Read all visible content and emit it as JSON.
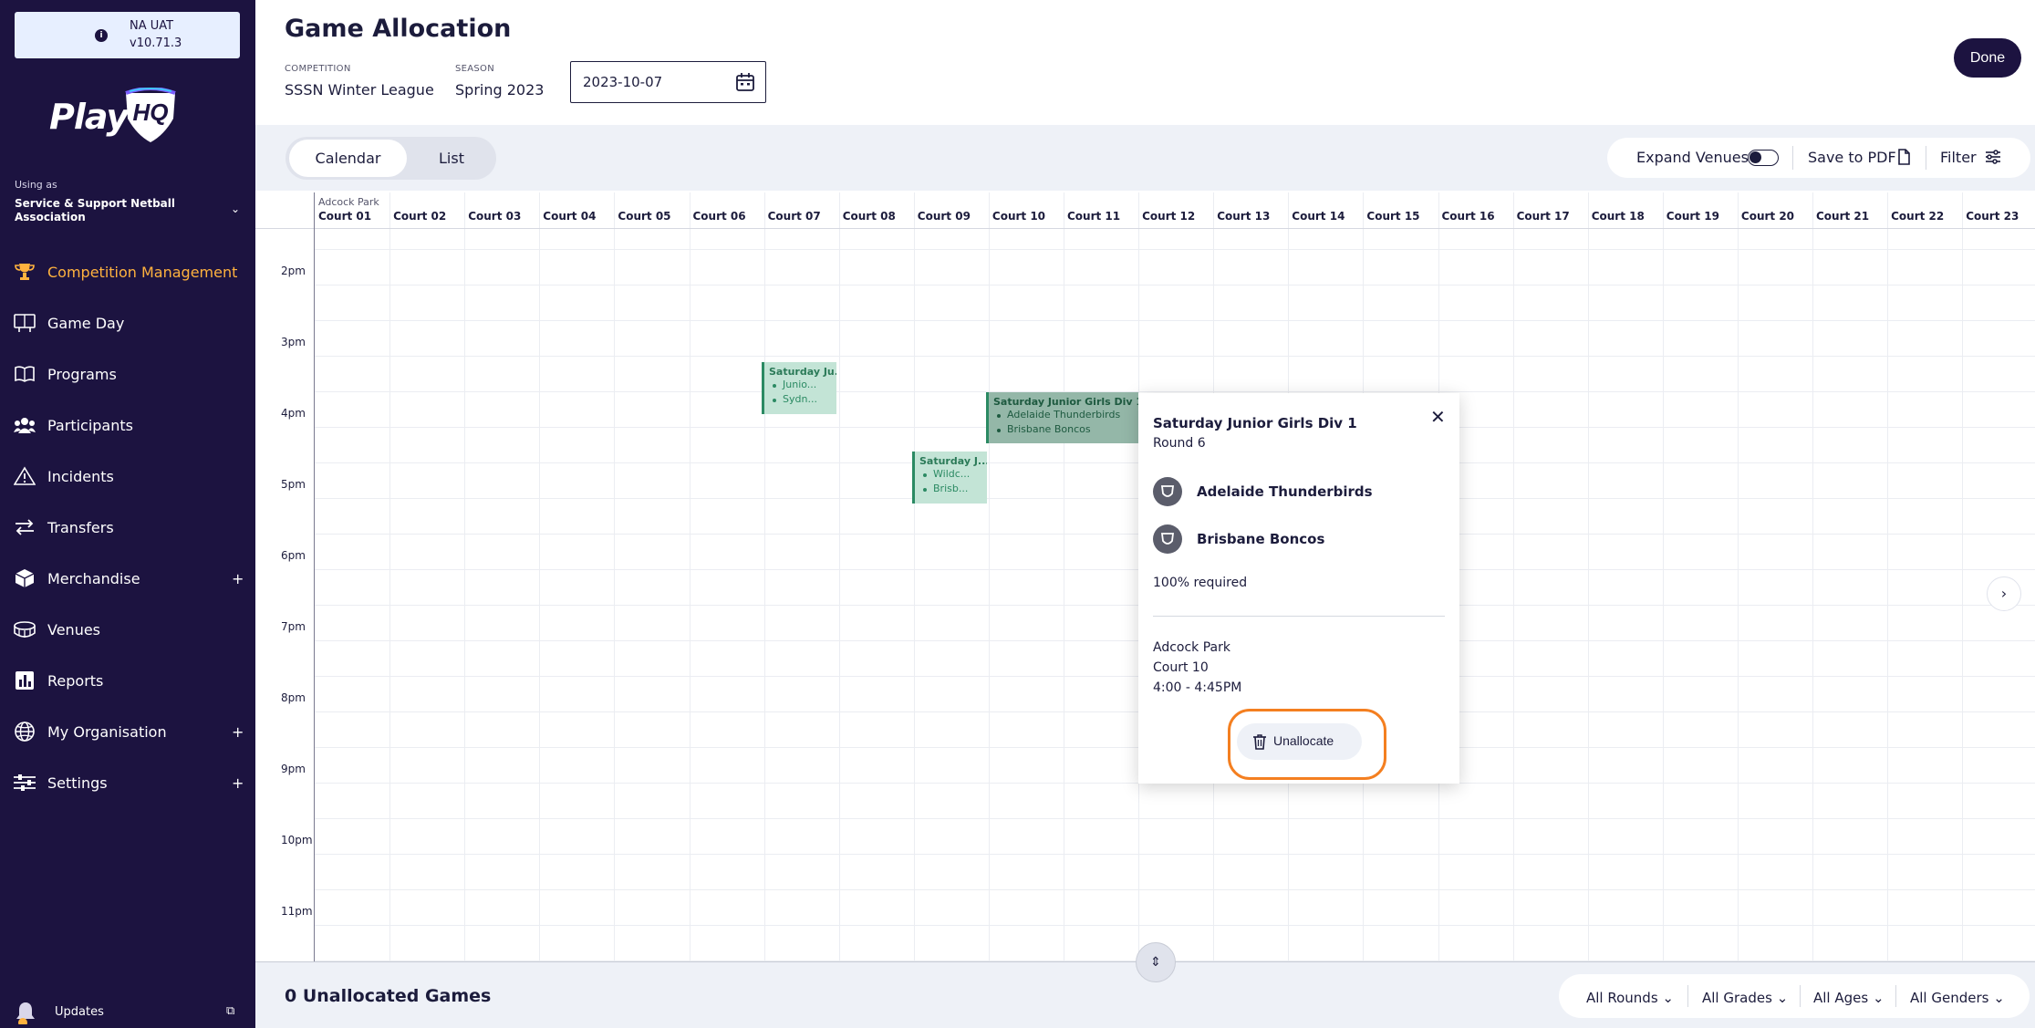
{
  "env": {
    "name": "NA UAT",
    "version": "v10.71.3"
  },
  "brand": {
    "play": "Play",
    "hq": "HQ",
    "accent": "#ffb23e",
    "sidebar_bg": "#1c1340"
  },
  "account": {
    "using_as_label": "Using as",
    "org": "Service & Support Netball Association"
  },
  "nav": [
    {
      "label": "Competition Management",
      "icon": "trophy-icon",
      "active": true
    },
    {
      "label": "Game Day",
      "icon": "scoreboard-icon"
    },
    {
      "label": "Programs",
      "icon": "book-icon"
    },
    {
      "label": "Participants",
      "icon": "people-icon"
    },
    {
      "label": "Incidents",
      "icon": "warning-icon"
    },
    {
      "label": "Transfers",
      "icon": "transfer-arrows-icon"
    },
    {
      "label": "Merchandise",
      "icon": "box-icon",
      "expand": "+"
    },
    {
      "label": "Venues",
      "icon": "stadium-icon"
    },
    {
      "label": "Reports",
      "icon": "chart-icon"
    },
    {
      "label": "My Organisation",
      "icon": "globe-icon",
      "expand": "+"
    },
    {
      "label": "Settings",
      "icon": "sliders-icon",
      "expand": "+"
    }
  ],
  "updates": {
    "label": "Updates"
  },
  "header": {
    "title": "Game Allocation",
    "competition_label": "COMPETITION",
    "competition": "SSSN Winter League",
    "season_label": "SEASON",
    "season": "Spring 2023",
    "date": "2023-10-07",
    "done": "Done"
  },
  "toolbar": {
    "calendar": "Calendar",
    "list": "List",
    "expand_venues": "Expand Venues",
    "save_pdf": "Save to PDF",
    "filter": "Filter"
  },
  "calendar": {
    "venue": "Adcock Park",
    "courts": [
      "Court 01",
      "Court 02",
      "Court 03",
      "Court 04",
      "Court 05",
      "Court 06",
      "Court 07",
      "Court 08",
      "Court 09",
      "Court 10",
      "Court 11",
      "Court 12",
      "Court 13",
      "Court 14",
      "Court 15",
      "Court 16",
      "Court 17",
      "Court 18",
      "Court 19",
      "Court 20",
      "Court 21",
      "Court 22",
      "Court 23"
    ],
    "times": [
      "2pm",
      "3pm",
      "4pm",
      "5pm",
      "6pm",
      "7pm",
      "8pm",
      "9pm",
      "10pm",
      "11pm"
    ],
    "games": [
      {
        "title": "Saturday Ju...",
        "team1": "Junio...",
        "team2": "Sydn..."
      },
      {
        "title": "Saturday Junior Girls Div 1",
        "team1": "Adelaide Thunderbirds",
        "team2": "Brisbane Boncos"
      },
      {
        "title": "Saturday J...",
        "team1": "Wildc...",
        "team2": "Brisb..."
      }
    ]
  },
  "popover": {
    "title": "Saturday Junior Girls Div 1",
    "round": "Round 6",
    "team1": "Adelaide Thunderbirds",
    "team2": "Brisbane Boncos",
    "required": "100% required",
    "venue": "Adcock Park",
    "court": "Court 10",
    "time": "4:00 - 4:45PM",
    "unallocate": "Unallocate",
    "highlight_color": "#f47f20"
  },
  "footer": {
    "unallocated": "0 Unallocated Games",
    "filters": [
      "All Rounds",
      "All Grades",
      "All Ages",
      "All Genders"
    ]
  }
}
